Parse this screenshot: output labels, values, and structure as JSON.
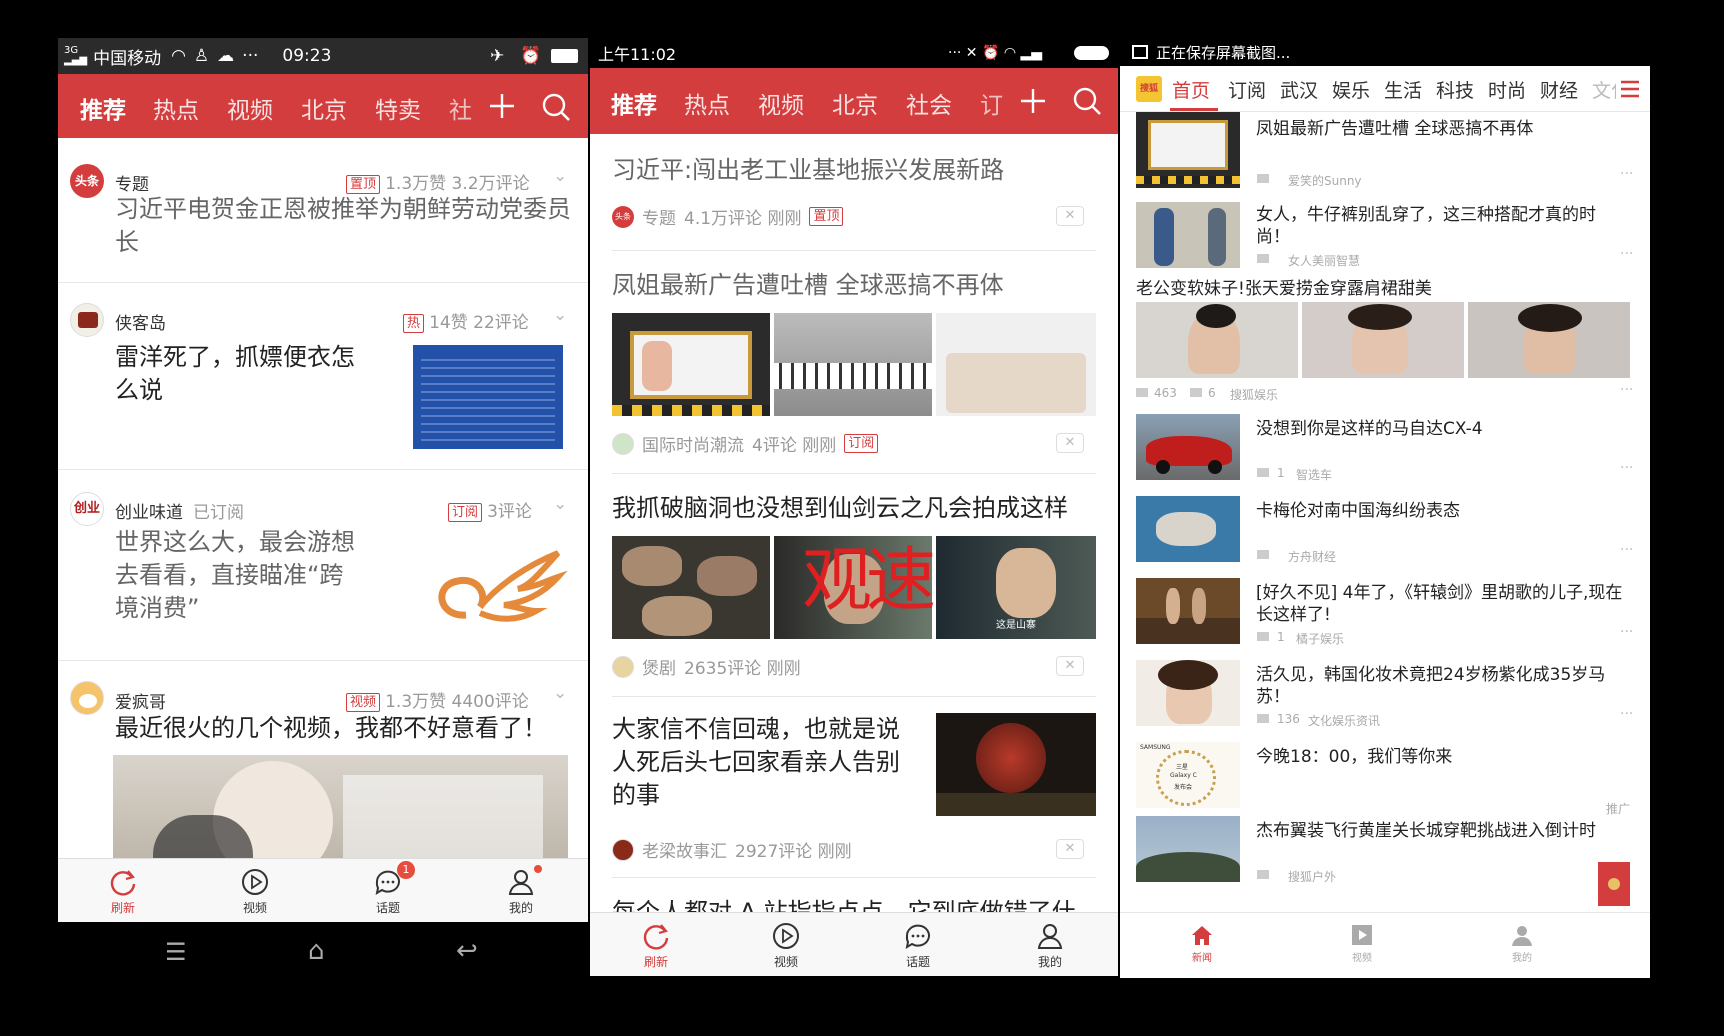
{
  "left": {
    "status": {
      "carrier": "中国移动",
      "time": "09:23",
      "signal_label": "3G"
    },
    "nav": {
      "tabs": [
        "推荐",
        "热点",
        "视频",
        "北京",
        "特卖",
        "社"
      ]
    },
    "articles": [
      {
        "source": "专题",
        "badge": "置顶",
        "stats": "1.3万赞 3.2万评论",
        "title": "习近平电贺金正恩被推举为朝鲜劳动党委员长"
      },
      {
        "source": "侠客岛",
        "badge": "热",
        "stats": "14赞 22评论",
        "title": "雷洋死了，抓嫖便衣怎么说"
      },
      {
        "source": "创业味道",
        "subscribed": "已订阅",
        "badge": "订阅",
        "stats": "3评论",
        "title": "世界这么大，最会游想去看看，直接瞄准“跨境消费”"
      },
      {
        "source": "爱疯哥",
        "badge": "视频",
        "stats": "1.3万赞 4400评论",
        "title": "最近很火的几个视频，我都不好意看了！"
      }
    ],
    "source_logos": {
      "toutiao": "头条",
      "chuangye": "创业"
    },
    "bottom": {
      "items": [
        "刷新",
        "视频",
        "话题",
        "我的"
      ],
      "topic_badge": "1"
    }
  },
  "middle": {
    "status": {
      "time": "上午11:02"
    },
    "nav": {
      "tabs": [
        "推荐",
        "热点",
        "视频",
        "北京",
        "社会",
        "订"
      ]
    },
    "articles": [
      {
        "title": "习近平:闯出老工业基地振兴发展新路",
        "source": "专题",
        "meta": "4.1万评论  刚刚",
        "badge": "置顶",
        "logo": "头条"
      },
      {
        "title": "凤姐最新广告遭吐槽 全球恶搞不再体",
        "source": "国际时尚潮流",
        "meta": "4评论  刚刚",
        "badge": "订阅"
      },
      {
        "title": "我抓破脑洞也没想到仙剑云之凡会拍成这样",
        "source": "煲剧",
        "meta": "2635评论  刚刚",
        "overlay": "观速",
        "caption": "这是山寨"
      },
      {
        "title": "大家信不信回魂，也就是说人死后头七回家看亲人告别的事",
        "source": "老梁故事汇",
        "meta": "2927评论  刚刚"
      },
      {
        "title": "每个人都对 A 站指指点点，它到底做错了什"
      }
    ],
    "close_label": "✕",
    "bottom": {
      "items": [
        "刷新",
        "视频",
        "话题",
        "我的"
      ]
    }
  },
  "right": {
    "status": {
      "text": "正在保存屏幕截图..."
    },
    "nav": {
      "logo": "搜狐",
      "tabs": [
        "首页",
        "订阅",
        "武汉",
        "娱乐",
        "生活",
        "科技",
        "时尚",
        "财经",
        "文化"
      ]
    },
    "items": [
      {
        "title": "凤姐最新广告遭吐槽 全球恶搞不再体",
        "source": "爱笑的Sunny"
      },
      {
        "title": "女人，牛仔裤别乱穿了，这三种搭配才真的时尚！",
        "source": "女人美丽智慧"
      },
      {
        "title": "没想到你是这样的马自达CX-4",
        "count": "1",
        "source": "智选车"
      },
      {
        "title": "卡梅伦对南中国海纠纷表态",
        "source": "方舟财经"
      },
      {
        "title": "[好久不见] 4年了，《轩辕剑》里胡歌的儿子,现在长这样了!",
        "count": "1",
        "source": "橘子娱乐"
      },
      {
        "title": "活久见，韩国化妆术竟把24岁杨紫化成35岁马苏！",
        "count": "136",
        "source": "文化娱乐资讯"
      },
      {
        "title": "今晚18：00，我们等你来",
        "tag": "推广",
        "ad_brand": "SAMSUNG",
        "ad_lines": [
          "三星",
          "Galaxy C",
          "发布会"
        ]
      },
      {
        "title": "杰布翼装飞行黄崖关长城穿靶挑战进入倒计时",
        "source": "搜狐户外"
      }
    ],
    "gallery": {
      "title": "老公变软妹子!张天爱捞金穿露肩裙甜美",
      "likes": "463",
      "comments": "6",
      "source": "搜狐娱乐"
    },
    "bottom": {
      "items": [
        "新闻",
        "视频",
        "我的"
      ]
    }
  }
}
